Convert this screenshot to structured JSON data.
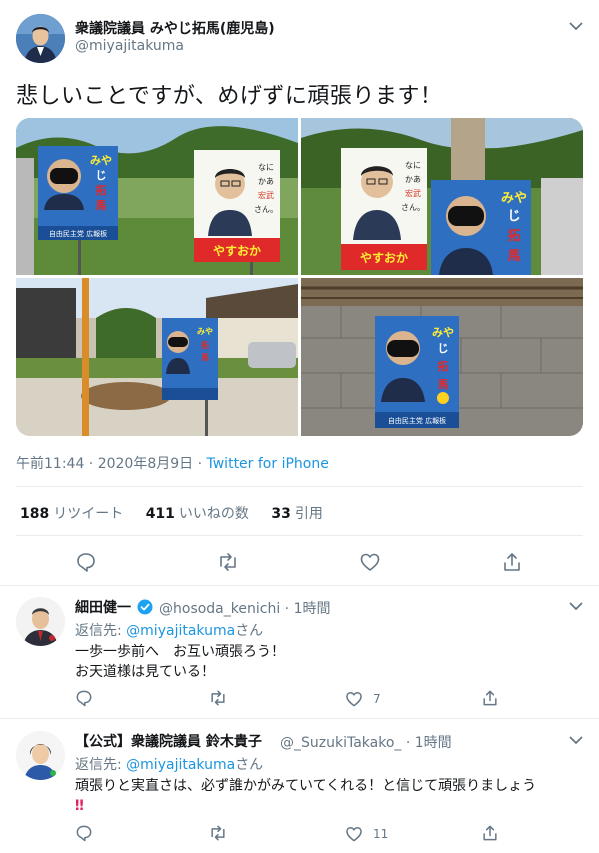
{
  "main_tweet": {
    "author_name": "衆議院議員 みやじ拓馬(鹿児島)",
    "author_handle": "@miyajitakuma",
    "text": "悲しいことですが、めげずに頑張ります！",
    "photos": [
      {
        "poster_left_name": "みやじ拓馬",
        "poster_right_name": "やすおか宏武",
        "poster_right_slogan": "なにかあったら宏武さん。"
      },
      {
        "poster_left_name": "やすおか宏武",
        "poster_left_slogan": "なにかあったら宏武さん。",
        "poster_right_name": "みやじ拓馬"
      },
      {
        "poster_name": "みやじ拓馬"
      },
      {
        "poster_name": "みやじ拓馬"
      }
    ],
    "poster_party": "自由民主党 広報板",
    "timestamp": "午前11:44 · 2020年8月9日",
    "separator": " · ",
    "source": "Twitter for iPhone",
    "stats": {
      "retweets": "188",
      "retweets_label": "リツイート",
      "likes": "411",
      "likes_label": "いいねの数",
      "quotes": "33",
      "quotes_label": "引用"
    },
    "icons": [
      "reply-icon",
      "retweet-icon",
      "like-icon",
      "share-icon"
    ]
  },
  "replies": [
    {
      "name": "細田健一",
      "handle": "@hosoda_kenichi",
      "time": "· 1時間",
      "reply_to_prefix": "返信先: ",
      "reply_to_mention": "@miyajitakuma",
      "reply_to_suffix": "さん",
      "lines": [
        "一歩一歩前へ　お互い頑張ろう！",
        "お天道様は見ている！"
      ],
      "like_count": "7",
      "verified": true
    },
    {
      "name": "【公式】衆議院議員 鈴木貴子",
      "handle": "@_SuzukiTakako_",
      "time": "· 1時間",
      "reply_to_prefix": "返信先: ",
      "reply_to_mention": "@miyajitakuma",
      "reply_to_suffix": "さん",
      "lines": [
        "頑張りと実直さは、必ず誰かがみていてくれる！と信じて頑張りましょう",
        "‼"
      ],
      "like_count": "11",
      "verified": false
    }
  ],
  "colors": {
    "link": "#1b95e0",
    "secondary_text": "#657786",
    "divider": "#e6ecf0",
    "verified": "#1da1f2",
    "emphasis": "#e0245e"
  }
}
